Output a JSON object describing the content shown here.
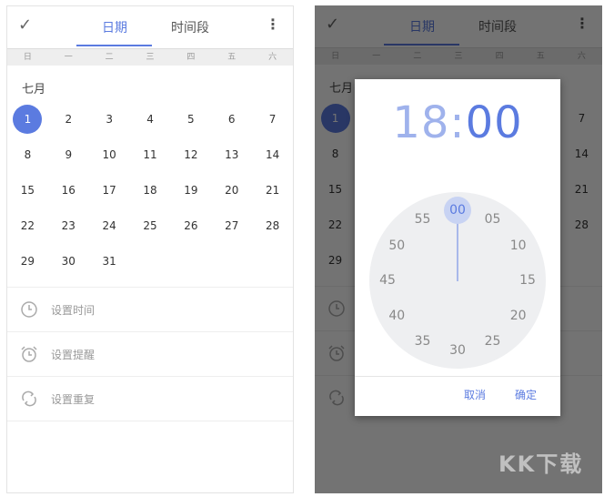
{
  "tabs": {
    "date": "日期",
    "range": "时间段"
  },
  "weekdays": [
    "日",
    "一",
    "二",
    "三",
    "四",
    "五",
    "六"
  ],
  "month": "七月",
  "days": [
    [
      "1",
      "2",
      "3",
      "4",
      "5",
      "6",
      "7"
    ],
    [
      "8",
      "9",
      "10",
      "11",
      "12",
      "13",
      "14"
    ],
    [
      "15",
      "16",
      "17",
      "18",
      "19",
      "20",
      "21"
    ],
    [
      "22",
      "23",
      "24",
      "25",
      "26",
      "27",
      "28"
    ],
    [
      "29",
      "30",
      "31"
    ]
  ],
  "selected_day": "1",
  "options": {
    "set_time": "设置时间",
    "set_reminder": "设置提醒",
    "set_repeat": "设置重复"
  },
  "dialog": {
    "hour": "18",
    "colon": ":",
    "minute": "00",
    "dial_numbers": [
      "00",
      "05",
      "10",
      "15",
      "20",
      "25",
      "30",
      "35",
      "40",
      "45",
      "50",
      "55"
    ],
    "cancel": "取消",
    "ok": "确定"
  },
  "watermark": "KK下载",
  "colors": {
    "accent": "#5b7be0",
    "accent_light": "#c8d3f3"
  }
}
